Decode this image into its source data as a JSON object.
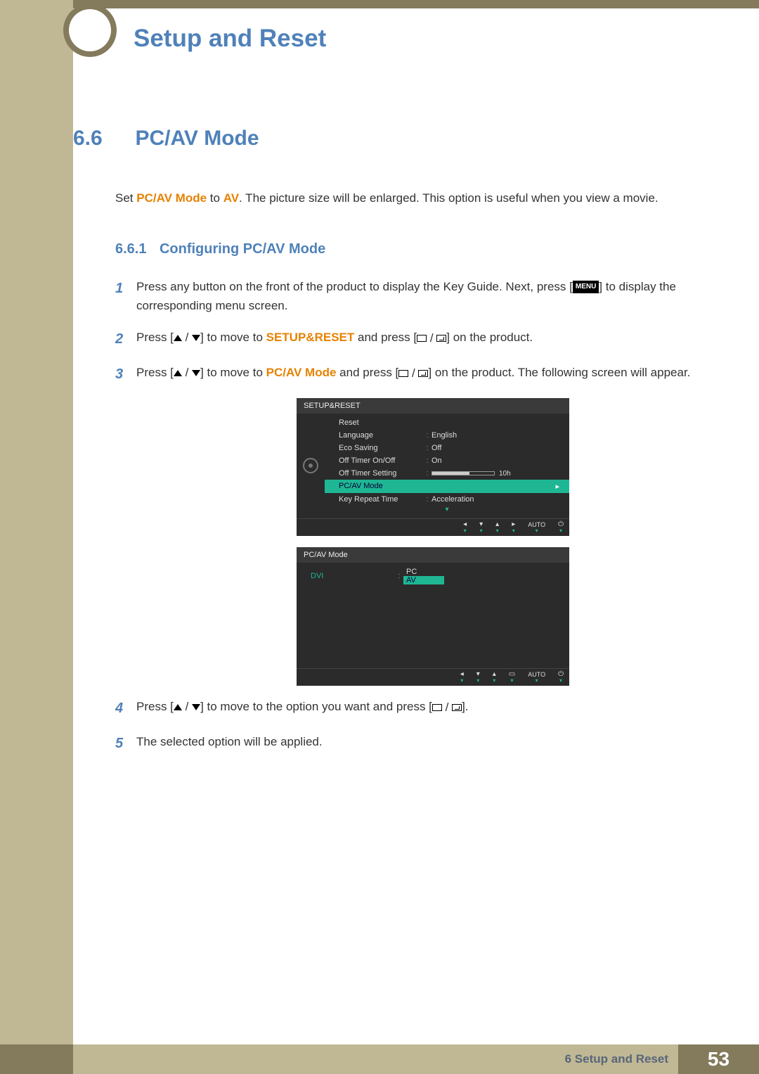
{
  "chapter_title": "Setup and Reset",
  "section": {
    "num": "6.6",
    "title": "PC/AV Mode"
  },
  "intro": {
    "prefix": "Set ",
    "kw1": "PC/AV Mode",
    "middle": " to ",
    "kw2": "AV",
    "suffix": ". The picture size will be enlarged. This option is useful when you view a movie."
  },
  "subsection": {
    "num": "6.6.1",
    "title": "Configuring PC/AV Mode"
  },
  "steps": {
    "s1": {
      "num": "1",
      "a": "Press any button on the front of the product to display the Key Guide. Next, press [",
      "menu": "MENU",
      "b": "] to display the corresponding menu screen."
    },
    "s2": {
      "num": "2",
      "a": "Press [",
      "b": "] to move to ",
      "kw": "SETUP&RESET",
      "c": " and press [",
      "d": "] on the product."
    },
    "s3": {
      "num": "3",
      "a": "Press [",
      "b": "] to move to ",
      "kw": "PC/AV Mode",
      "c": " and press [",
      "d": "] on the product. The following screen will appear."
    },
    "s4": {
      "num": "4",
      "a": "Press [",
      "b": "] to move to the option you want and press [",
      "c": "]."
    },
    "s5": {
      "num": "5",
      "text": "The selected option will be applied."
    }
  },
  "osd1": {
    "header": "SETUP&RESET",
    "items": {
      "reset": "Reset",
      "language": {
        "label": "Language",
        "value": "English"
      },
      "eco": {
        "label": "Eco Saving",
        "value": "Off"
      },
      "timer_onoff": {
        "label": "Off Timer On/Off",
        "value": "On"
      },
      "timer_setting": {
        "label": "Off Timer Setting",
        "value": "10h"
      },
      "pcav": "PC/AV Mode",
      "keyrepeat": {
        "label": "Key Repeat Time",
        "value": "Acceleration"
      }
    },
    "footer_auto": "AUTO"
  },
  "osd2": {
    "header": "PC/AV Mode",
    "dvi": "DVI",
    "pc": "PC",
    "av": "AV",
    "footer_auto": "AUTO"
  },
  "footer": {
    "chapter": "6 Setup and Reset",
    "page": "53"
  }
}
